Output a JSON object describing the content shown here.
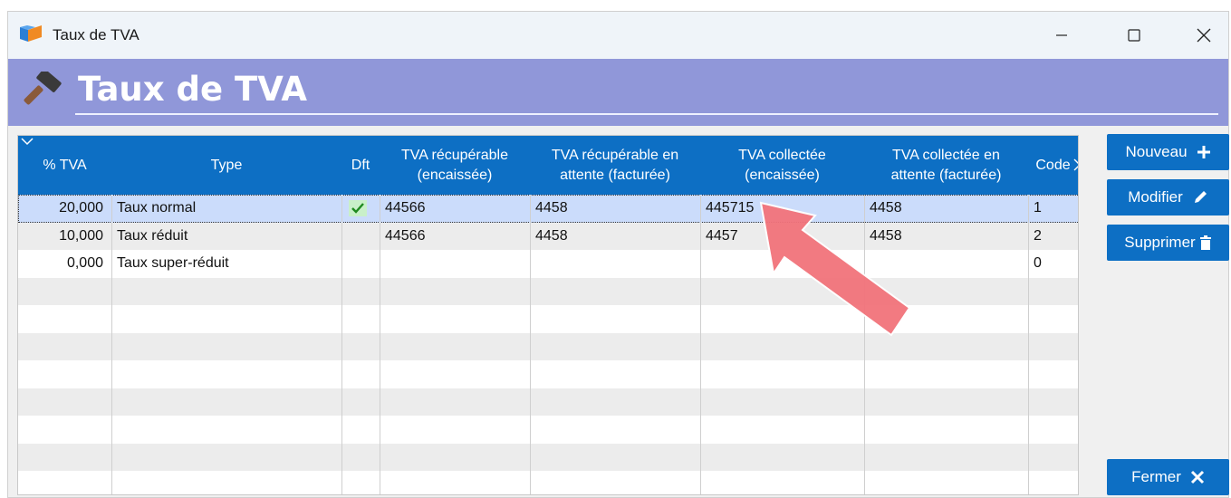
{
  "window": {
    "title": "Taux de TVA",
    "icon": "app-logo-icon",
    "controls": [
      "minimize-icon",
      "maximize-icon",
      "close-icon"
    ]
  },
  "header": {
    "icon": "hammer-icon",
    "title": "Taux de TVA",
    "background": "#9097d9"
  },
  "grid": {
    "columns": [
      {
        "key": "rate",
        "label": "% TVA"
      },
      {
        "key": "type",
        "label": "Type"
      },
      {
        "key": "default",
        "label": "Dft"
      },
      {
        "key": "recov_cash",
        "label": "TVA récupérable\n(encaissée)"
      },
      {
        "key": "recov_pending",
        "label": "TVA récupérable en\nattente (facturée)"
      },
      {
        "key": "coll_cash",
        "label": "TVA collectée\n(encaissée)"
      },
      {
        "key": "coll_pending",
        "label": "TVA collectée en\nattente (facturée)"
      },
      {
        "key": "code",
        "label": "Code"
      }
    ],
    "rows": [
      {
        "rate": "20,000",
        "type": "Taux normal",
        "default": true,
        "recov_cash": "44566",
        "recov_pending": "4458",
        "coll_cash": "445715",
        "coll_pending": "4458",
        "code": "1",
        "selected": true
      },
      {
        "rate": "10,000",
        "type": "Taux réduit",
        "default": false,
        "recov_cash": "44566",
        "recov_pending": "4458",
        "coll_cash": "4457",
        "coll_pending": "4458",
        "code": "2",
        "selected": false
      },
      {
        "rate": "0,000",
        "type": "Taux super-réduit",
        "default": false,
        "recov_cash": "",
        "recov_pending": "",
        "coll_cash": "",
        "coll_pending": "",
        "code": "0",
        "selected": false
      }
    ],
    "header_color": "#0d6fc4",
    "selected_row_color": "#cbdcfb"
  },
  "actions": {
    "new_label": "Nouveau",
    "edit_label": "Modifier",
    "delete_label": "Supprimer",
    "close_label": "Fermer",
    "button_color": "#0d6fc4"
  },
  "annotation": {
    "type": "arrow",
    "color": "#f2737b"
  }
}
